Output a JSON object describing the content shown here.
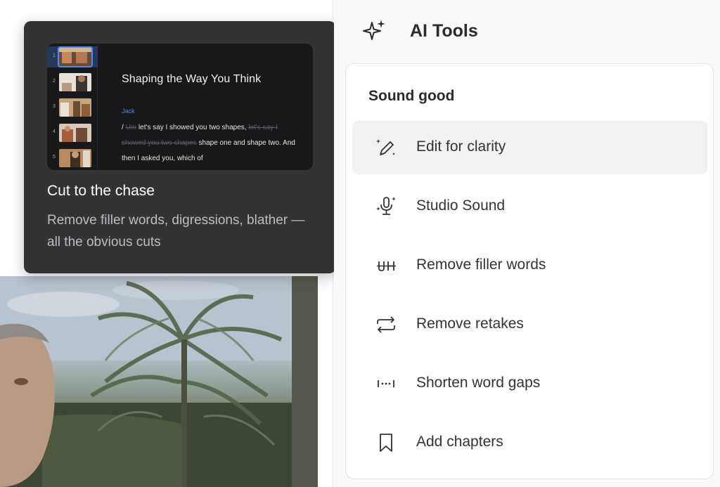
{
  "preview": {
    "title": "Shaping the Way You Think",
    "speaker": "Jack",
    "transcript": {
      "marker": "/",
      "struck_1": "Um",
      "normal_1": "let's say I showed you two shapes,",
      "struck_2": "let's say I showed you two shapes",
      "normal_2": "shape one and shape two. And then I asked you, which of"
    },
    "scenes": [
      {
        "num": "1",
        "active": true
      },
      {
        "num": "2"
      },
      {
        "num": "3"
      },
      {
        "num": "4"
      },
      {
        "num": "5"
      }
    ]
  },
  "tooltip": {
    "title": "Cut to the chase",
    "description": "Remove filler words, digressions, blather — all the obvious cuts"
  },
  "panel": {
    "title": "AI Tools",
    "title_icon": "sparkle-icon",
    "section": "Sound good",
    "items": [
      {
        "label": "Edit for clarity",
        "icon": "magic-pen-icon",
        "hovered": true
      },
      {
        "label": "Studio Sound",
        "icon": "sparkle-microphone-icon"
      },
      {
        "label": "Remove filler words",
        "icon": "strikethrough-tally-icon"
      },
      {
        "label": "Remove retakes",
        "icon": "repeat-arrows-icon"
      },
      {
        "label": "Shorten word gaps",
        "icon": "gap-dots-icon"
      },
      {
        "label": "Add chapters",
        "icon": "bookmark-icon"
      }
    ]
  },
  "colors": {
    "tooltip_bg": "#333335",
    "accent_blue": "#4a8cff",
    "panel_bg": "#faf9f8",
    "hover_bg": "#f1f1f1"
  }
}
